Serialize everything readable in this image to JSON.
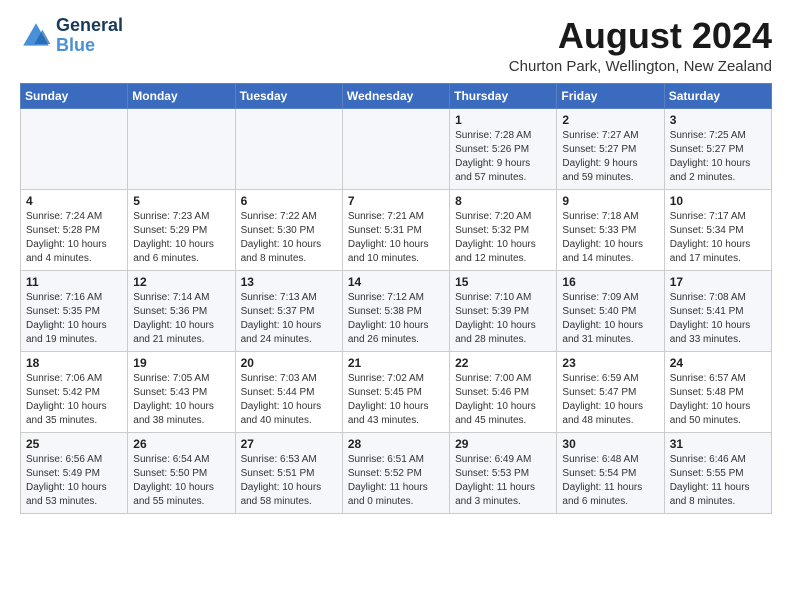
{
  "logo": {
    "line1": "General",
    "line2": "Blue"
  },
  "header": {
    "month_year": "August 2024",
    "location": "Churton Park, Wellington, New Zealand"
  },
  "weekdays": [
    "Sunday",
    "Monday",
    "Tuesday",
    "Wednesday",
    "Thursday",
    "Friday",
    "Saturday"
  ],
  "weeks": [
    [
      {
        "day": "",
        "info": ""
      },
      {
        "day": "",
        "info": ""
      },
      {
        "day": "",
        "info": ""
      },
      {
        "day": "",
        "info": ""
      },
      {
        "day": "1",
        "info": "Sunrise: 7:28 AM\nSunset: 5:26 PM\nDaylight: 9 hours\nand 57 minutes."
      },
      {
        "day": "2",
        "info": "Sunrise: 7:27 AM\nSunset: 5:27 PM\nDaylight: 9 hours\nand 59 minutes."
      },
      {
        "day": "3",
        "info": "Sunrise: 7:25 AM\nSunset: 5:27 PM\nDaylight: 10 hours\nand 2 minutes."
      }
    ],
    [
      {
        "day": "4",
        "info": "Sunrise: 7:24 AM\nSunset: 5:28 PM\nDaylight: 10 hours\nand 4 minutes."
      },
      {
        "day": "5",
        "info": "Sunrise: 7:23 AM\nSunset: 5:29 PM\nDaylight: 10 hours\nand 6 minutes."
      },
      {
        "day": "6",
        "info": "Sunrise: 7:22 AM\nSunset: 5:30 PM\nDaylight: 10 hours\nand 8 minutes."
      },
      {
        "day": "7",
        "info": "Sunrise: 7:21 AM\nSunset: 5:31 PM\nDaylight: 10 hours\nand 10 minutes."
      },
      {
        "day": "8",
        "info": "Sunrise: 7:20 AM\nSunset: 5:32 PM\nDaylight: 10 hours\nand 12 minutes."
      },
      {
        "day": "9",
        "info": "Sunrise: 7:18 AM\nSunset: 5:33 PM\nDaylight: 10 hours\nand 14 minutes."
      },
      {
        "day": "10",
        "info": "Sunrise: 7:17 AM\nSunset: 5:34 PM\nDaylight: 10 hours\nand 17 minutes."
      }
    ],
    [
      {
        "day": "11",
        "info": "Sunrise: 7:16 AM\nSunset: 5:35 PM\nDaylight: 10 hours\nand 19 minutes."
      },
      {
        "day": "12",
        "info": "Sunrise: 7:14 AM\nSunset: 5:36 PM\nDaylight: 10 hours\nand 21 minutes."
      },
      {
        "day": "13",
        "info": "Sunrise: 7:13 AM\nSunset: 5:37 PM\nDaylight: 10 hours\nand 24 minutes."
      },
      {
        "day": "14",
        "info": "Sunrise: 7:12 AM\nSunset: 5:38 PM\nDaylight: 10 hours\nand 26 minutes."
      },
      {
        "day": "15",
        "info": "Sunrise: 7:10 AM\nSunset: 5:39 PM\nDaylight: 10 hours\nand 28 minutes."
      },
      {
        "day": "16",
        "info": "Sunrise: 7:09 AM\nSunset: 5:40 PM\nDaylight: 10 hours\nand 31 minutes."
      },
      {
        "day": "17",
        "info": "Sunrise: 7:08 AM\nSunset: 5:41 PM\nDaylight: 10 hours\nand 33 minutes."
      }
    ],
    [
      {
        "day": "18",
        "info": "Sunrise: 7:06 AM\nSunset: 5:42 PM\nDaylight: 10 hours\nand 35 minutes."
      },
      {
        "day": "19",
        "info": "Sunrise: 7:05 AM\nSunset: 5:43 PM\nDaylight: 10 hours\nand 38 minutes."
      },
      {
        "day": "20",
        "info": "Sunrise: 7:03 AM\nSunset: 5:44 PM\nDaylight: 10 hours\nand 40 minutes."
      },
      {
        "day": "21",
        "info": "Sunrise: 7:02 AM\nSunset: 5:45 PM\nDaylight: 10 hours\nand 43 minutes."
      },
      {
        "day": "22",
        "info": "Sunrise: 7:00 AM\nSunset: 5:46 PM\nDaylight: 10 hours\nand 45 minutes."
      },
      {
        "day": "23",
        "info": "Sunrise: 6:59 AM\nSunset: 5:47 PM\nDaylight: 10 hours\nand 48 minutes."
      },
      {
        "day": "24",
        "info": "Sunrise: 6:57 AM\nSunset: 5:48 PM\nDaylight: 10 hours\nand 50 minutes."
      }
    ],
    [
      {
        "day": "25",
        "info": "Sunrise: 6:56 AM\nSunset: 5:49 PM\nDaylight: 10 hours\nand 53 minutes."
      },
      {
        "day": "26",
        "info": "Sunrise: 6:54 AM\nSunset: 5:50 PM\nDaylight: 10 hours\nand 55 minutes."
      },
      {
        "day": "27",
        "info": "Sunrise: 6:53 AM\nSunset: 5:51 PM\nDaylight: 10 hours\nand 58 minutes."
      },
      {
        "day": "28",
        "info": "Sunrise: 6:51 AM\nSunset: 5:52 PM\nDaylight: 11 hours\nand 0 minutes."
      },
      {
        "day": "29",
        "info": "Sunrise: 6:49 AM\nSunset: 5:53 PM\nDaylight: 11 hours\nand 3 minutes."
      },
      {
        "day": "30",
        "info": "Sunrise: 6:48 AM\nSunset: 5:54 PM\nDaylight: 11 hours\nand 6 minutes."
      },
      {
        "day": "31",
        "info": "Sunrise: 6:46 AM\nSunset: 5:55 PM\nDaylight: 11 hours\nand 8 minutes."
      }
    ]
  ]
}
